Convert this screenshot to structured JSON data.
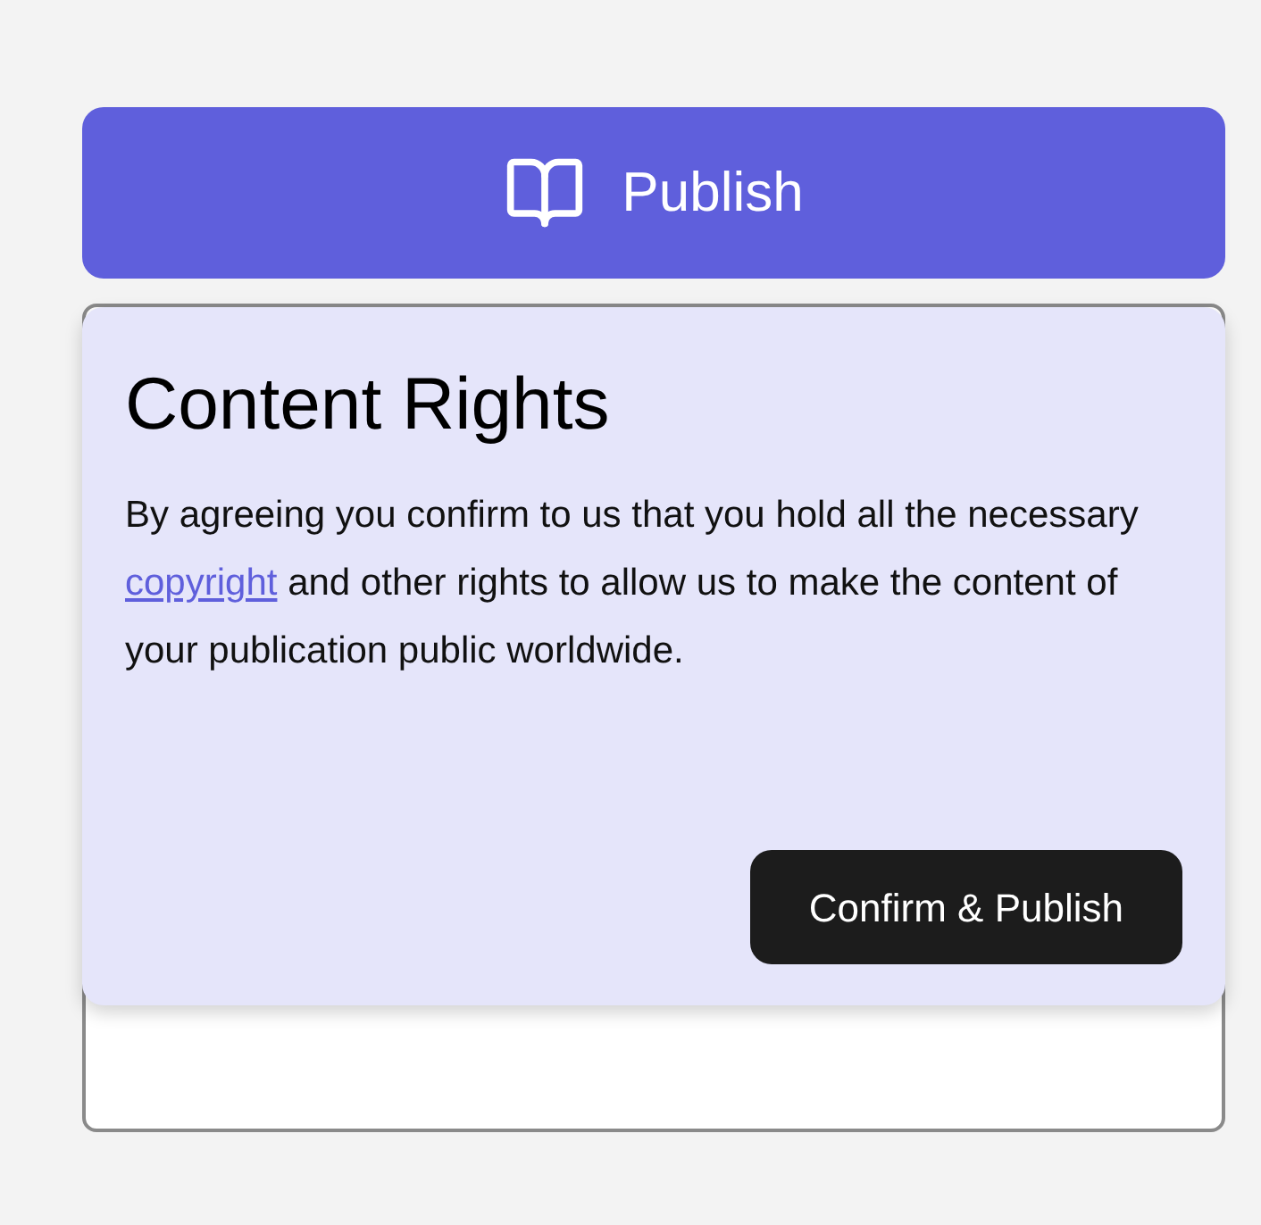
{
  "publish_button": {
    "label": "Publish"
  },
  "popover": {
    "title": "Content Rights",
    "text_before": "By agreeing you confirm to us that you hold all the necessary",
    "link": "copyright",
    "text_after": "and other rights to allow us to make the content of your publication public worldwide.",
    "confirm_button": "Confirm & Publish"
  }
}
